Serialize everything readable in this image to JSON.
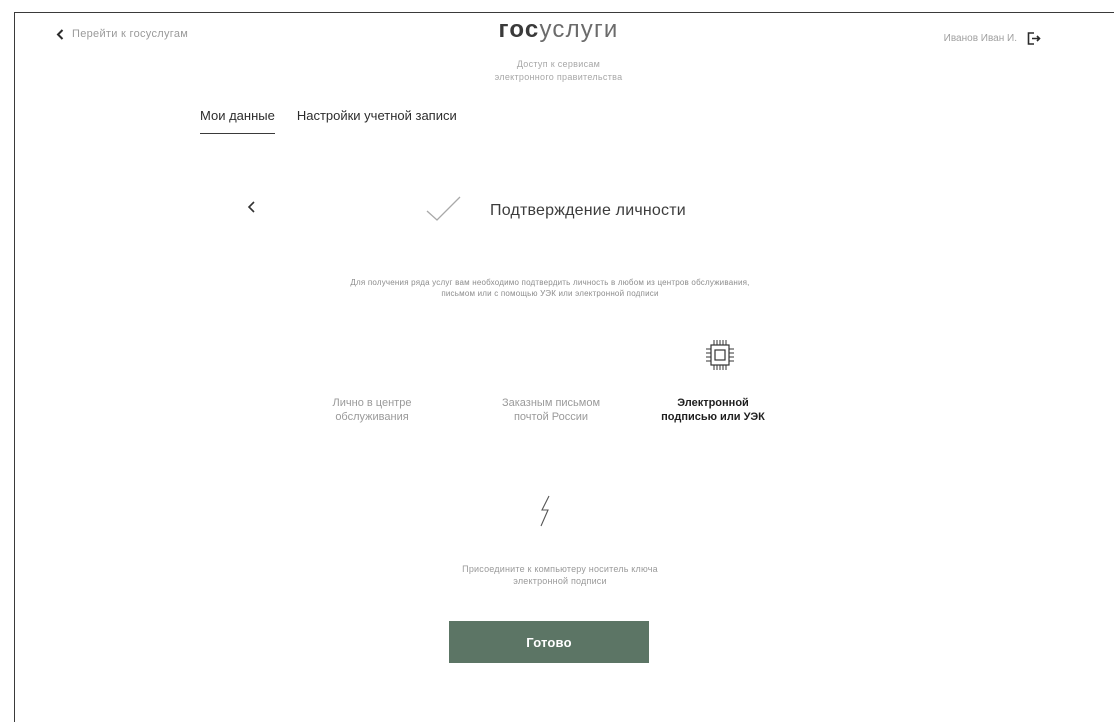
{
  "header": {
    "back_label": "Перейти к госуслугам",
    "logo_bold": "гос",
    "logo_light": "услуги",
    "subtitle_line1": "Доступ к сервисам",
    "subtitle_line2": "электронного правительства",
    "user_name": "Иванов Иван И.",
    "logout_icon": "logout-icon"
  },
  "tabs": [
    {
      "label": "Мои данные",
      "active": true
    },
    {
      "label": "Настройки учетной записи",
      "active": false
    }
  ],
  "step": {
    "title": "Подтверждение личности",
    "description_line1": "Для получения ряда услуг вам необходимо подтвердить личность в любом из центров обслуживания,",
    "description_line2": "письмом или с помощью УЭК или электронной подписи"
  },
  "options": [
    {
      "label_line1": "Лично в центре",
      "label_line2": "обслуживания",
      "icon": "person-icon",
      "selected": false
    },
    {
      "label_line1": "Заказным письмом",
      "label_line2": "почтой России",
      "icon": "mail-icon",
      "selected": false
    },
    {
      "label_line1": "Электронной",
      "label_line2": "подписью или УЭК",
      "icon": "chip-icon",
      "selected": true
    }
  ],
  "instruction": {
    "line1": "Присоедините к компьютеру носитель ключа",
    "line2": "электронной подписи"
  },
  "done_label": "Готово",
  "colors": {
    "accent": "#5c7565",
    "text": "#2b2b2b",
    "muted": "#9a9a9a"
  }
}
